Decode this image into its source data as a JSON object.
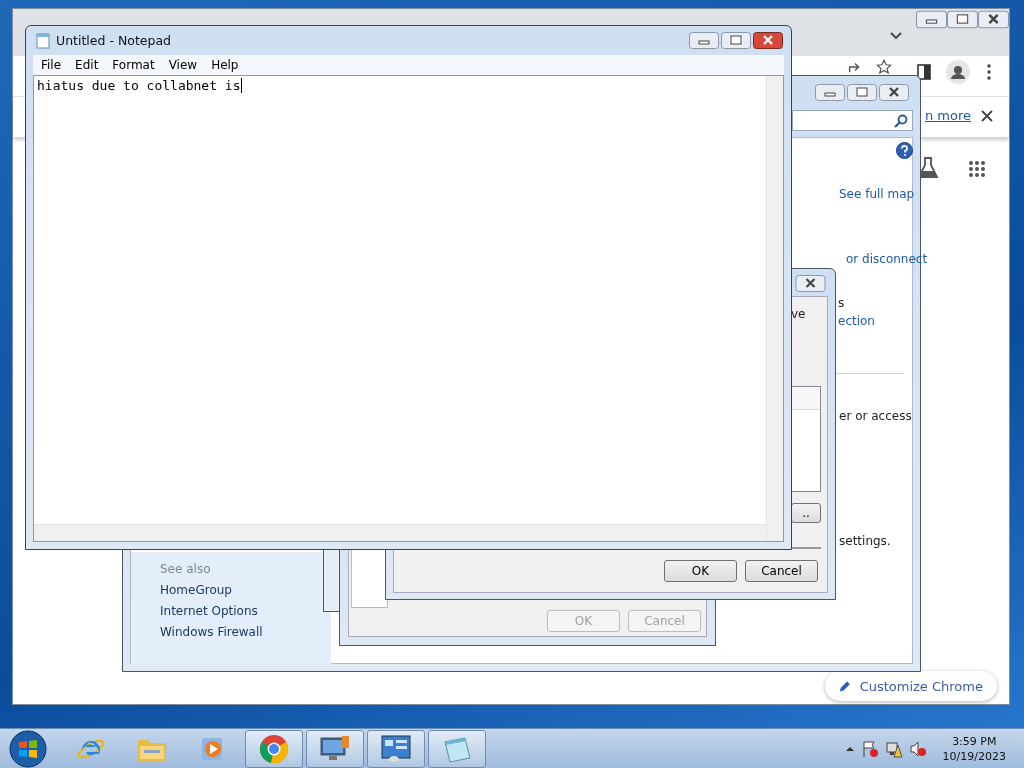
{
  "chrome": {
    "info_link": "n more",
    "customize_button": "Customize Chrome"
  },
  "network_window": {
    "see_full_map": "See full map",
    "disconnect_link": "or disconnect",
    "fragment_s": "s",
    "connection_link": "ection",
    "access_text": "er or access",
    "settings_text": "settings.",
    "see_also": {
      "heading": "See also",
      "items": [
        "HomeGroup",
        "Internet Options",
        "Windows Firewall"
      ]
    }
  },
  "back_dialog": {
    "buttons": [
      {
        "label": "OK",
        "disabled": true
      },
      {
        "label": "Cancel",
        "disabled": true
      }
    ]
  },
  "front_dialog": {
    "text": "ve",
    "more_button": "..",
    "buttons": [
      {
        "label": "OK",
        "disabled": false
      },
      {
        "label": "Cancel",
        "disabled": false
      }
    ]
  },
  "notepad": {
    "title": "Untitled - Notepad",
    "menu": [
      "File",
      "Edit",
      "Format",
      "View",
      "Help"
    ],
    "text": "hiatus due to collabnet is"
  },
  "taskbar": {
    "apps": [
      {
        "kind": "ie",
        "running": false
      },
      {
        "kind": "explorer",
        "running": false
      },
      {
        "kind": "media",
        "running": false
      },
      {
        "kind": "chrome",
        "running": true
      },
      {
        "kind": "network",
        "running": true
      },
      {
        "kind": "control",
        "running": true
      },
      {
        "kind": "notepad",
        "running": true
      }
    ],
    "time": "3:59 PM",
    "date": "10/19/2023"
  }
}
